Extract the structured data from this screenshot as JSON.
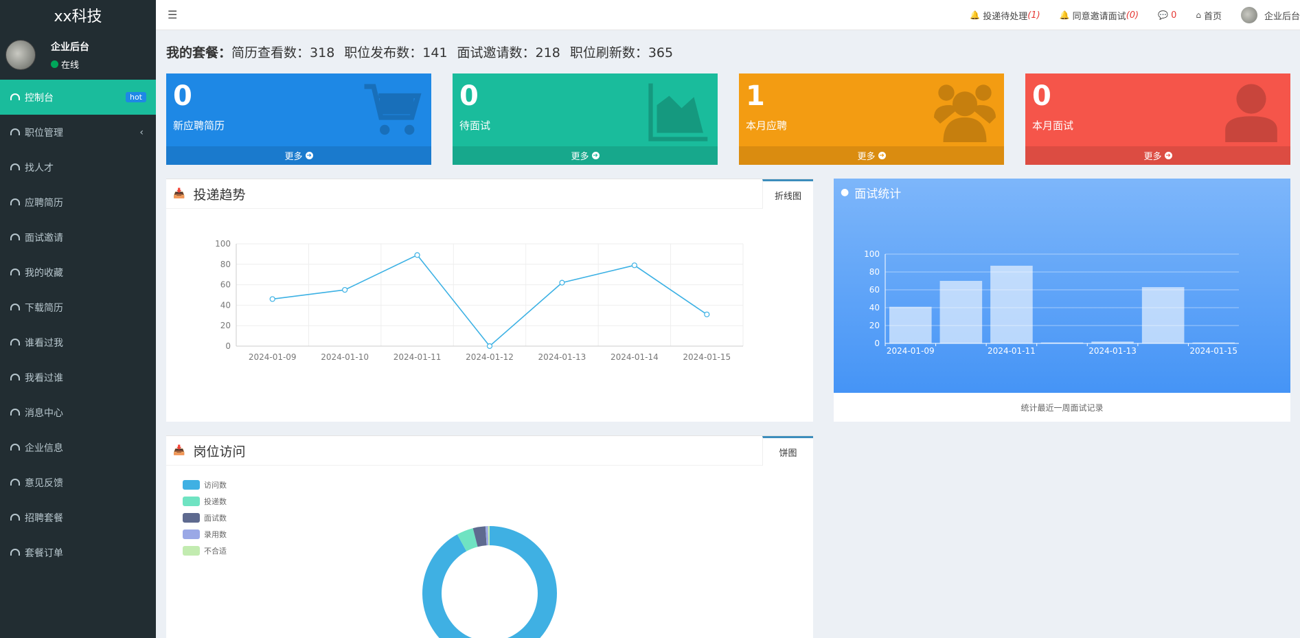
{
  "brand": "xx科技",
  "user": {
    "name": "企业后台",
    "status": "在线"
  },
  "menu": [
    {
      "label": "控制台",
      "badge": "hot",
      "active": true
    },
    {
      "label": "职位管理",
      "chevron": "‹"
    },
    {
      "label": "找人才"
    },
    {
      "label": "应聘简历"
    },
    {
      "label": "面试邀请"
    },
    {
      "label": "我的收藏"
    },
    {
      "label": "下载简历"
    },
    {
      "label": "谁看过我"
    },
    {
      "label": "我看过谁"
    },
    {
      "label": "消息中心"
    },
    {
      "label": "企业信息"
    },
    {
      "label": "意见反馈"
    },
    {
      "label": "招聘套餐"
    },
    {
      "label": "套餐订单"
    }
  ],
  "topbar": {
    "delivery_label": "投递待处理",
    "delivery_count": "(1)",
    "agree_label": "同意邀请面试",
    "agree_count": "(0)",
    "msg_count": "0",
    "home": "首页",
    "account": "企业后台"
  },
  "package": {
    "title": "我的套餐：",
    "items": [
      "简历查看数：318",
      "职位发布数：141",
      "面试邀请数：218",
      "职位刷新数：365"
    ]
  },
  "cards": [
    {
      "value": "0",
      "label": "新应聘简历",
      "more": "更多",
      "color": "#1e88e5",
      "icon": "cart-icon"
    },
    {
      "value": "0",
      "label": "待面试",
      "more": "更多",
      "color": "#1abc9c",
      "icon": "area-chart-icon"
    },
    {
      "value": "1",
      "label": "本月应聘",
      "more": "更多",
      "color": "#f39c12",
      "icon": "users-icon"
    },
    {
      "value": "0",
      "label": "本月面试",
      "more": "更多",
      "color": "#f5554a",
      "icon": "user-icon"
    }
  ],
  "trend": {
    "title": "投递趋势",
    "tab": "折线图"
  },
  "interview": {
    "title": "面试统计",
    "caption": "统计最近一周面试记录"
  },
  "visits": {
    "title": "岗位访问",
    "tab": "饼图"
  },
  "chart_data": [
    {
      "type": "line",
      "x": [
        "2024-01-09",
        "2024-01-10",
        "2024-01-11",
        "2024-01-12",
        "2024-01-13",
        "2024-01-14",
        "2024-01-15"
      ],
      "values": [
        46,
        55,
        89,
        0,
        62,
        79,
        31
      ],
      "ylim": [
        0,
        100
      ],
      "yticks": [
        0,
        20,
        40,
        60,
        80,
        100
      ],
      "color": "#3cb1e4",
      "grid": true
    },
    {
      "type": "bar",
      "x": [
        "2024-01-09",
        "2024-01-10",
        "2024-01-11",
        "2024-01-12",
        "2024-01-13",
        "2024-01-14",
        "2024-01-15"
      ],
      "xtick_labels": [
        "2024-01-09",
        "",
        "2024-01-11",
        "",
        "2024-01-13",
        "",
        "2024-01-15"
      ],
      "values": [
        41,
        70,
        87,
        1,
        2,
        63,
        1
      ],
      "ylim": [
        0,
        100
      ],
      "yticks": [
        0,
        20,
        40,
        60,
        80,
        100
      ]
    },
    {
      "type": "pie",
      "legend": [
        "访问数",
        "投递数",
        "面试数",
        "录用数",
        "不合适"
      ],
      "colors": [
        "#3fb0e3",
        "#6fe3c2",
        "#5e6a8f",
        "#9aa8e6",
        "#c2ebb0"
      ],
      "values": [
        92,
        4,
        3,
        0.6,
        0.4
      ]
    }
  ]
}
